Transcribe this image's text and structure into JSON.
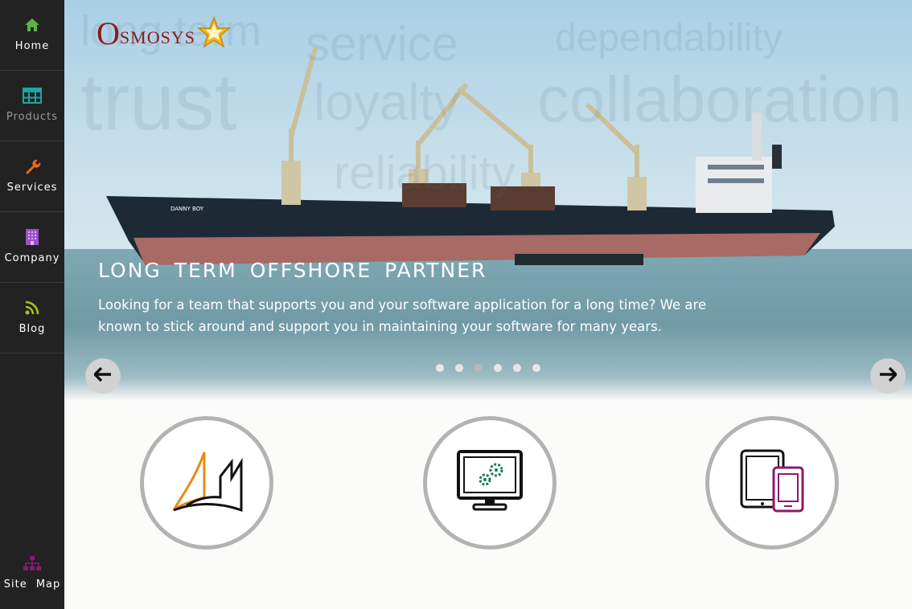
{
  "sidebar": {
    "items": [
      {
        "label": "Home",
        "icon": "home-icon",
        "color": "#5fb24a"
      },
      {
        "label": "Products",
        "icon": "grid-icon",
        "color": "#1aa7a0"
      },
      {
        "label": "Services",
        "icon": "wrench-icon",
        "color": "#e86a1a"
      },
      {
        "label": "Company",
        "icon": "building-icon",
        "color": "#9b4fc8"
      },
      {
        "label": "Blog",
        "icon": "rss-icon",
        "color": "#a6c41c"
      }
    ],
    "sitemap": {
      "label": "Site Map",
      "icon": "sitemap-icon",
      "color": "#8a1a6e"
    }
  },
  "logo": {
    "first_letter": "O",
    "rest": "SMOSYS",
    "icon": "star-icon"
  },
  "hero": {
    "title": "LONG TERM OFFSHORE PARTNER",
    "text": "Looking for a team that supports you and your software application for a long time? We are known to stick around and support you in maintaining your software for many years.",
    "watermarks": [
      "long term",
      "service",
      "dependability",
      "trust",
      "loyalty",
      "collaboration",
      "reliability"
    ],
    "ship_name": "DANNY BOY",
    "slides": 6,
    "active_slide": 3,
    "prev_icon": "arrow-left-icon",
    "next_icon": "arrow-right-icon"
  },
  "features": [
    {
      "icon": "dynamics-logo-icon"
    },
    {
      "icon": "monitor-gears-icon"
    },
    {
      "icon": "tablet-phone-icon"
    }
  ]
}
